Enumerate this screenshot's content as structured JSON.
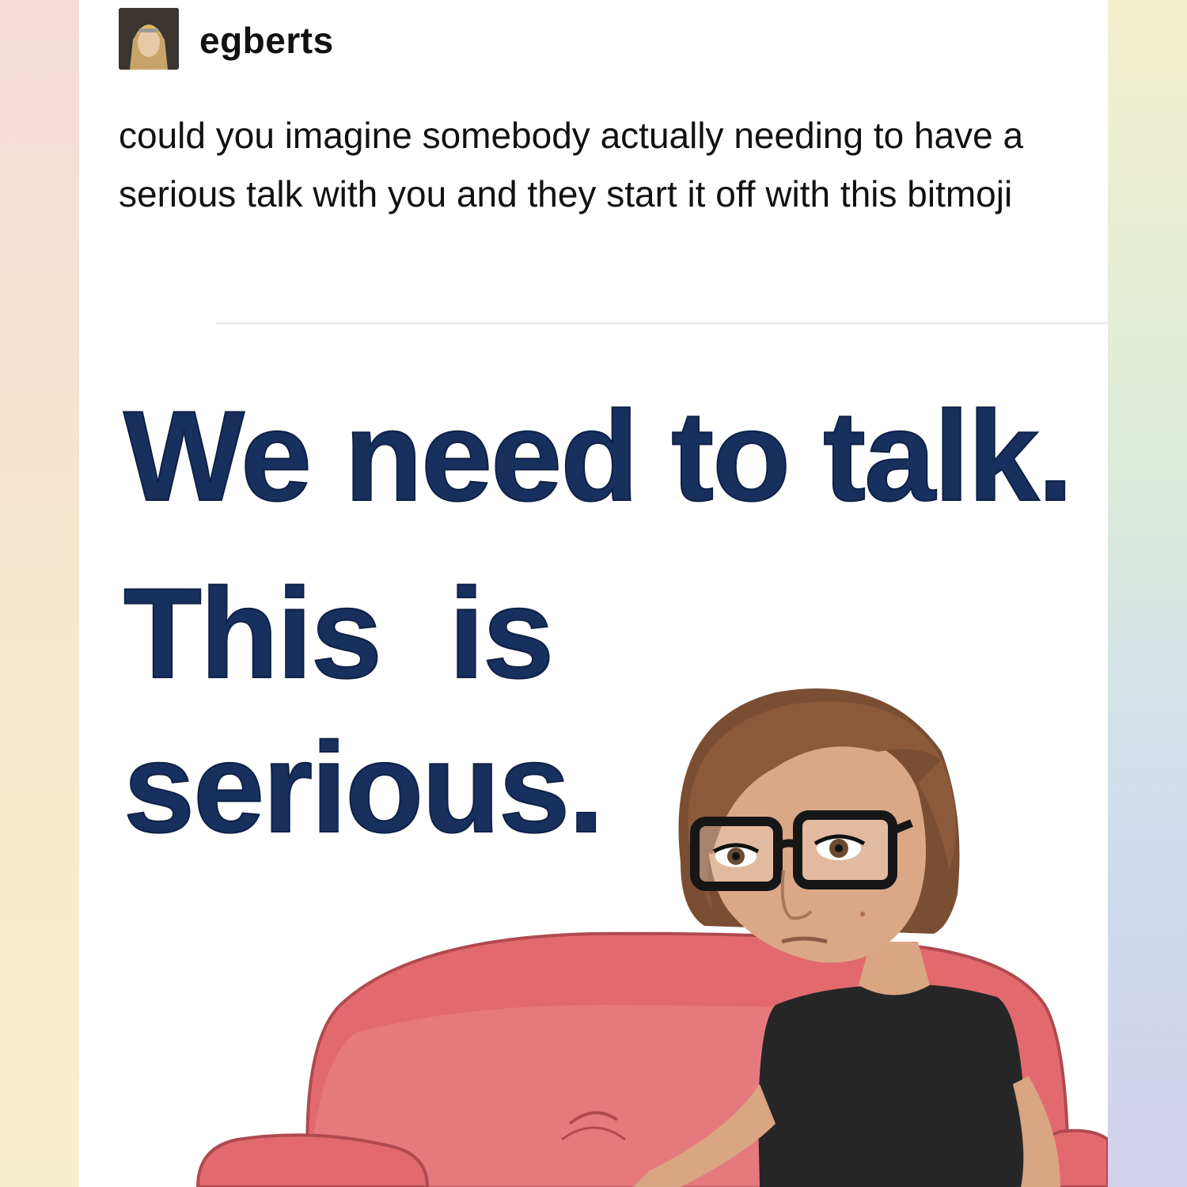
{
  "post": {
    "username": "egberts",
    "text": "could you imagine somebody actually needing to have a serious talk with you and they start it off with this bitmoji"
  },
  "bitmoji": {
    "line1": "We need to talk.",
    "line2": "This  is",
    "line3": "serious."
  },
  "colors": {
    "headline": "#17305e",
    "couch": "#e26a6e",
    "shirt": "#262626",
    "hair": "#8a5a3b"
  }
}
